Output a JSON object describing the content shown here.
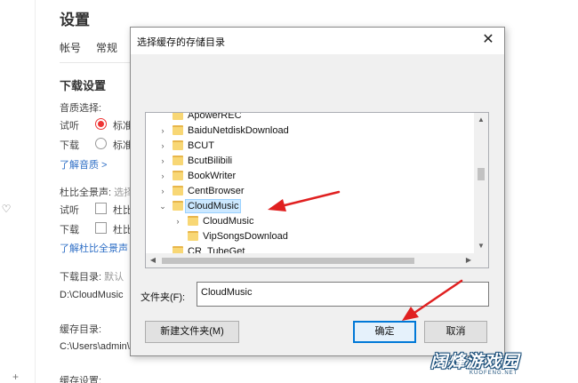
{
  "settings": {
    "title": "设置",
    "tabs": [
      "帐号",
      "常规"
    ],
    "download_heading": "下载设置",
    "quality_label": "音质选择:",
    "listen_label": "试听",
    "download_label": "下载",
    "quality_option": "标准",
    "quality_option2": "标准",
    "learn_quality": "了解音质 >",
    "dolby_label": "杜比全景声:",
    "dolby_hint": "选择",
    "dolby_listen": "试听",
    "dolby_download": "下载",
    "dolby_option": "杜比",
    "dolby_option2": "杜比",
    "learn_dolby": "了解杜比全景声 >",
    "download_dir_label": "下载目录:",
    "download_dir_hint": "默认",
    "download_dir_value": "D:\\CloudMusic",
    "cache_dir_label": "缓存目录:",
    "cache_dir_value": "C:\\Users\\admin\\A",
    "cache_settings_label": "缓存设置:"
  },
  "dialog": {
    "title": "选择缓存的存储目录",
    "close_symbol": "✕",
    "tree": [
      {
        "label": "ApowerREC",
        "expander": "",
        "selected": false
      },
      {
        "label": "BaiduNetdiskDownload",
        "expander": "›",
        "selected": false
      },
      {
        "label": "BCUT",
        "expander": "›",
        "selected": false
      },
      {
        "label": "BcutBilibili",
        "expander": "›",
        "selected": false
      },
      {
        "label": "BookWriter",
        "expander": "›",
        "selected": false
      },
      {
        "label": "CentBrowser",
        "expander": "›",
        "selected": false
      },
      {
        "label": "CloudMusic",
        "expander": "⌄",
        "selected": true
      },
      {
        "label": "CloudMusic",
        "expander": "›",
        "selected": false
      },
      {
        "label": "VipSongsDownload",
        "expander": "",
        "selected": false
      },
      {
        "label": "CR_TubeGet",
        "expander": "",
        "selected": false
      }
    ],
    "folder_label": "文件夹(F):",
    "folder_value": "CloudMusic",
    "new_folder_button": "新建文件夹(M)",
    "ok_button": "确定",
    "cancel_button": "取消"
  },
  "watermark": {
    "text": "阔烽游戏园",
    "sub": "KUOFENG.NET"
  },
  "colors": {
    "accent_red": "#e33333",
    "link_blue": "#2f6fc6",
    "selection_bg": "#cce8ff",
    "ok_border": "#0078d7"
  }
}
